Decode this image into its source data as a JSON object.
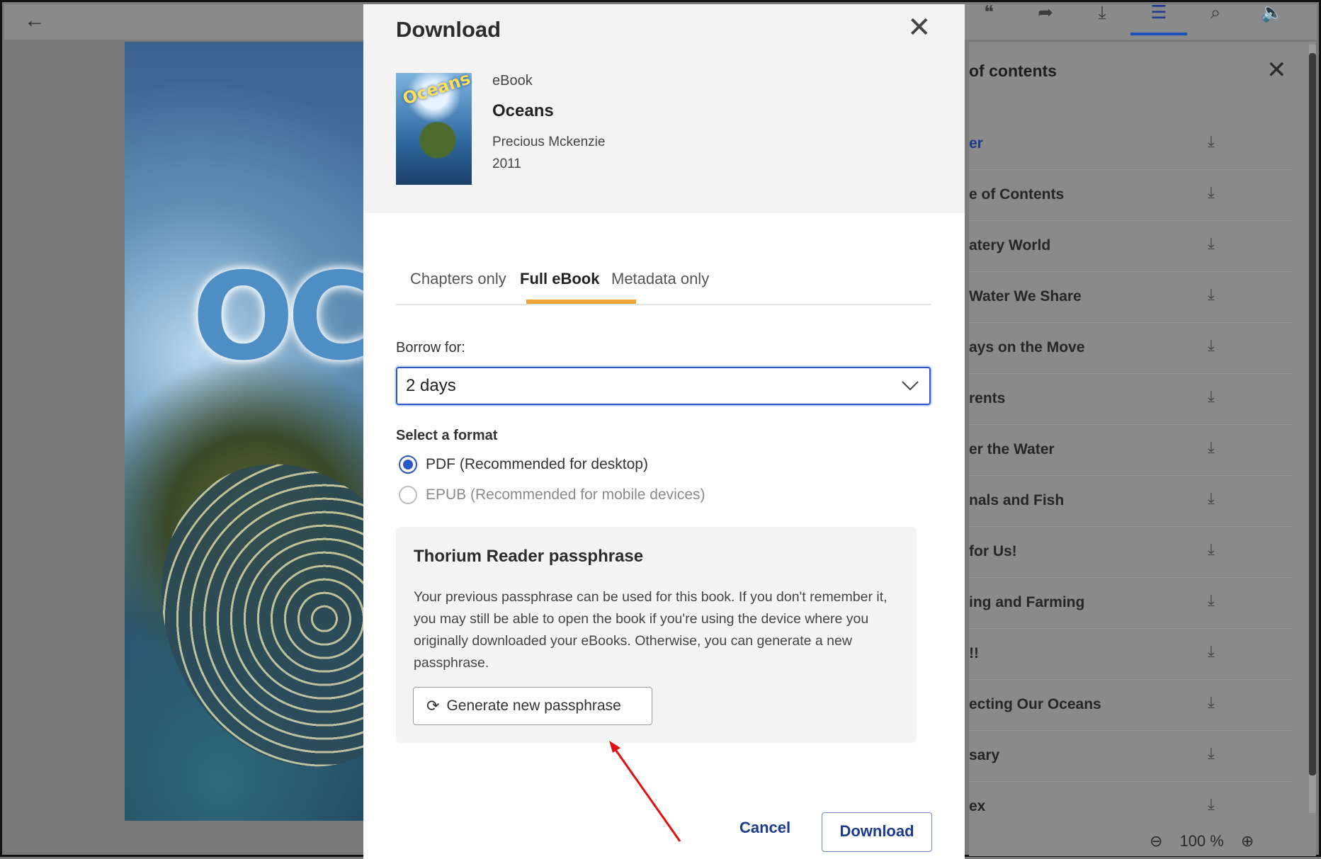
{
  "reader": {
    "toolbar_icons": [
      "quote-icon",
      "share-icon",
      "download-icon",
      "toc-icon",
      "search-icon",
      "audio-icon",
      "help-icon"
    ],
    "toc": {
      "title": "of contents",
      "items": [
        {
          "label": "er"
        },
        {
          "label": "e of Contents"
        },
        {
          "label": "atery World"
        },
        {
          "label": "Water We Share"
        },
        {
          "label": "ays on the Move"
        },
        {
          "label": "rents"
        },
        {
          "label": "er the Water"
        },
        {
          "label": "nals and Fish"
        },
        {
          "label": "for Us!"
        },
        {
          "label": "ing and Farming"
        },
        {
          "label": "!!"
        },
        {
          "label": "ecting Our Oceans"
        },
        {
          "label": "sary"
        },
        {
          "label": "ex"
        }
      ]
    },
    "zoom": {
      "minus": "⊖",
      "level": "100 %",
      "plus": "⊕"
    }
  },
  "modal": {
    "title": "Download",
    "book": {
      "type": "eBook",
      "title": "Oceans",
      "author": "Precious Mckenzie",
      "year": "2011",
      "cover_text": "Oceans"
    },
    "tabs": [
      {
        "label": "Chapters only",
        "active": false
      },
      {
        "label": "Full eBook",
        "active": true
      },
      {
        "label": "Metadata only",
        "active": false
      }
    ],
    "borrow": {
      "label": "Borrow for:",
      "value": "2 days"
    },
    "format": {
      "label": "Select a format",
      "options": [
        {
          "label": "PDF (Recommended for desktop)",
          "checked": true
        },
        {
          "label": "EPUB (Recommended for mobile devices)",
          "checked": false
        }
      ]
    },
    "passphrase": {
      "title": "Thorium Reader passphrase",
      "text": "Your previous passphrase can be used for this book. If you don't remember it, you may still be able to open the book if you're using the device where you originally downloaded your eBooks. Otherwise, you can generate a new passphrase.",
      "button": "Generate new passphrase"
    },
    "actions": {
      "cancel": "Cancel",
      "download": "Download"
    }
  },
  "colors": {
    "accent": "#2a57c6",
    "tab_underline": "#f0a43a",
    "annotation_arrow": "#e01010"
  }
}
